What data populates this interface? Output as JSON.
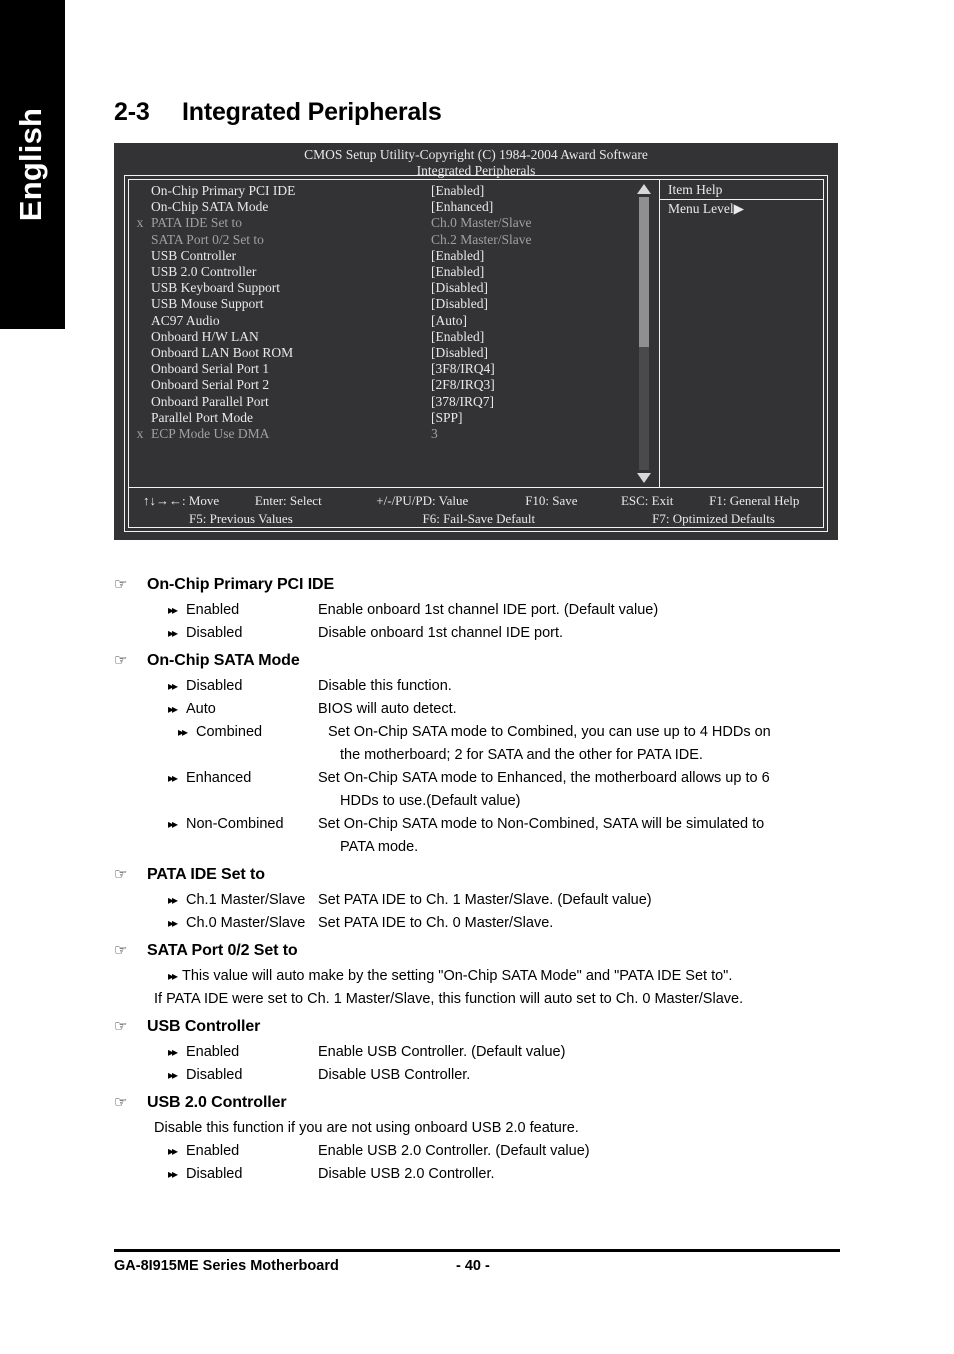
{
  "language_tab": "English",
  "section": {
    "number": "2-3",
    "title": "Integrated Peripherals"
  },
  "bios": {
    "header_line1": "CMOS Setup Utility-Copyright (C) 1984-2004 Award Software",
    "header_line2": "Integrated Peripherals",
    "items": [
      {
        "mark": "",
        "name": "On-Chip Primary PCI IDE",
        "value": "[Enabled]",
        "dim": false
      },
      {
        "mark": "",
        "name": "On-Chip SATA Mode",
        "value": "[Enhanced]",
        "dim": false
      },
      {
        "mark": "x",
        "name": "PATA IDE Set to",
        "value": "Ch.0 Master/Slave",
        "dim": true
      },
      {
        "mark": "",
        "name": "SATA Port 0/2 Set to",
        "value": "Ch.2 Master/Slave",
        "dim": true
      },
      {
        "mark": "",
        "name": "USB Controller",
        "value": "[Enabled]",
        "dim": false
      },
      {
        "mark": "",
        "name": "USB 2.0 Controller",
        "value": "[Enabled]",
        "dim": false
      },
      {
        "mark": "",
        "name": "USB Keyboard Support",
        "value": "[Disabled]",
        "dim": false
      },
      {
        "mark": "",
        "name": "USB Mouse Support",
        "value": "[Disabled]",
        "dim": false
      },
      {
        "mark": "",
        "name": "AC97 Audio",
        "value": "[Auto]",
        "dim": false
      },
      {
        "mark": "",
        "name": "Onboard H/W LAN",
        "value": "[Enabled]",
        "dim": false
      },
      {
        "mark": "",
        "name": "Onboard LAN Boot ROM",
        "value": "[Disabled]",
        "dim": false
      },
      {
        "mark": "",
        "name": "Onboard Serial Port 1",
        "value": "[3F8/IRQ4]",
        "dim": false
      },
      {
        "mark": "",
        "name": "Onboard Serial Port 2",
        "value": "[2F8/IRQ3]",
        "dim": false
      },
      {
        "mark": "",
        "name": "Onboard Parallel Port",
        "value": "[378/IRQ7]",
        "dim": false
      },
      {
        "mark": "",
        "name": "Parallel Port Mode",
        "value": "[SPP]",
        "dim": false
      },
      {
        "mark": "x",
        "name": "ECP Mode Use DMA",
        "value": "3",
        "dim": true
      }
    ],
    "help": {
      "title": "Item Help",
      "menu_level": "Menu Level",
      "menu_level_arrow": "▶"
    },
    "keys": {
      "move": "↑↓→←: Move",
      "enter": "Enter: Select",
      "value": "+/-/PU/PD: Value",
      "f10": "F10: Save",
      "esc": "ESC: Exit",
      "f1": "F1: General Help",
      "f5": "F5: Previous Values",
      "f6": "F6: Fail-Save Default",
      "f7": "F7: Optimized Defaults"
    },
    "colors": {
      "background": "#333335",
      "text": "#e9e9e9",
      "dim_text": "#a0a0a2",
      "border": "#f2f2f2",
      "scroll_thumb": "#8f8f91",
      "scroll_track": "#4a4a4c"
    }
  },
  "glyphs": {
    "hand": "☞",
    "double_arrow": "▸▸"
  },
  "sections": [
    {
      "id": "on-chip-primary-pci-ide",
      "title": "On-Chip Primary PCI IDE",
      "options": [
        {
          "label": "Enabled",
          "text": "Enable onboard 1st channel IDE port. (Default value)"
        },
        {
          "label": "Disabled",
          "text": "Disable onboard 1st channel IDE port."
        }
      ]
    },
    {
      "id": "on-chip-sata-mode",
      "title": "On-Chip SATA Mode",
      "options": [
        {
          "label": "Disabled",
          "text": "Disable this function."
        },
        {
          "label": "Auto",
          "text": "BIOS will auto detect."
        },
        {
          "label": "Combined",
          "text": "Set On-Chip SATA mode to Combined, you can use up to 4 HDDs on",
          "text2": "the motherboard; 2 for SATA and the other for PATA IDE."
        },
        {
          "label": "Enhanced",
          "text": "Set On-Chip SATA mode to Enhanced, the motherboard allows up to 6",
          "text2": "HDDs to use.(Default value)"
        },
        {
          "label": "Non-Combined",
          "text": "Set On-Chip SATA mode to Non-Combined, SATA will be simulated to",
          "text2": "PATA mode."
        }
      ]
    },
    {
      "id": "pata-ide-set-to",
      "title": "PATA IDE Set to",
      "options": [
        {
          "label": "Ch.1 Master/Slave",
          "text": "Set PATA IDE to Ch. 1 Master/Slave. (Default value)"
        },
        {
          "label": "Ch.0 Master/Slave",
          "text": "Set PATA IDE to Ch. 0 Master/Slave."
        }
      ]
    },
    {
      "id": "sata-port-0-2-set-to",
      "title": "SATA Port 0/2 Set to",
      "wide_option": "This value will auto make by the setting \"On-Chip SATA Mode\" and \"PATA IDE Set to\".",
      "wide_option_cont": "If PATA IDE were set to Ch. 1 Master/Slave, this function will auto set to Ch. 0 Master/Slave."
    },
    {
      "id": "usb-controller",
      "title": "USB Controller",
      "options": [
        {
          "label": "Enabled",
          "text": "Enable USB Controller. (Default value)"
        },
        {
          "label": "Disabled",
          "text": "Disable USB Controller."
        }
      ]
    },
    {
      "id": "usb-2-0-controller",
      "title": "USB 2.0 Controller",
      "note": "Disable this function if you are not using onboard USB 2.0 feature.",
      "options": [
        {
          "label": "Enabled",
          "text": "Enable USB 2.0 Controller. (Default value)"
        },
        {
          "label": "Disabled",
          "text": "Disable USB 2.0 Controller."
        }
      ]
    }
  ],
  "footer": {
    "product": "GA-8I915ME Series Motherboard",
    "page": "- 40 -"
  }
}
